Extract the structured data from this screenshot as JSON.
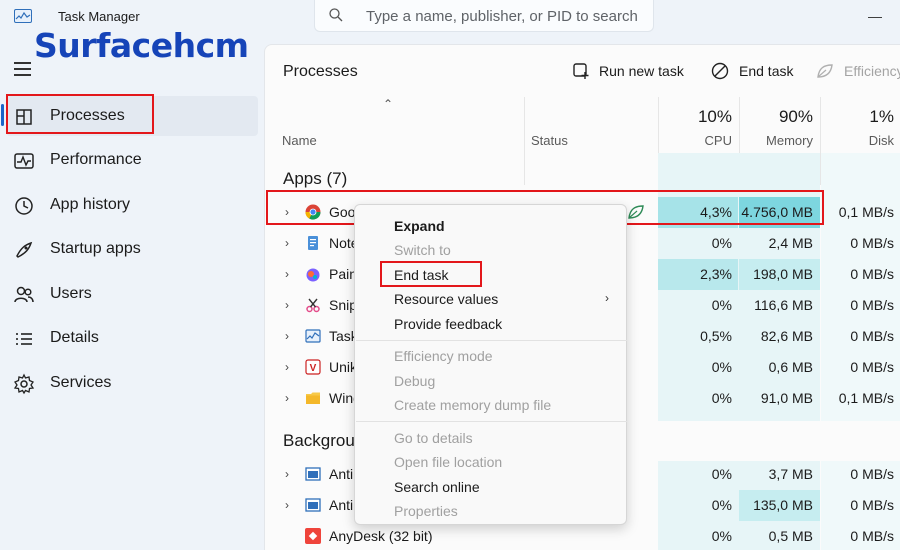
{
  "titlebar": {
    "app_title": "Task Manager",
    "search_placeholder": "Type a name, publisher, or PID to search",
    "minimize": "—",
    "maximize": "☐"
  },
  "watermark": "Surfacehcm",
  "sidebar": {
    "items": [
      {
        "label": "Processes",
        "icon": "processes-icon",
        "active": true
      },
      {
        "label": "Performance",
        "icon": "performance-icon"
      },
      {
        "label": "App history",
        "icon": "history-icon"
      },
      {
        "label": "Startup apps",
        "icon": "startup-icon"
      },
      {
        "label": "Users",
        "icon": "users-icon"
      },
      {
        "label": "Details",
        "icon": "details-icon"
      },
      {
        "label": "Services",
        "icon": "services-icon"
      }
    ]
  },
  "main": {
    "title": "Processes",
    "toolbar": {
      "run_new_task": "Run new task",
      "end_task": "End task",
      "efficiency": "Efficiency"
    },
    "columns": {
      "name": "Name",
      "status": "Status",
      "cpu_pct": "10%",
      "cpu": "CPU",
      "memory_pct": "90%",
      "memory": "Memory",
      "disk_pct": "1%",
      "disk": "Disk"
    },
    "groups": {
      "apps": "Apps (7)",
      "background": "Backgrou"
    },
    "rows": [
      {
        "name": "Goo",
        "icon": "chrome-icon",
        "cpu": "4,3%",
        "memory": "4.756,0 MB",
        "disk": "0,1 MB/s"
      },
      {
        "name": "Note",
        "icon": "notepad-icon",
        "cpu": "0%",
        "memory": "2,4 MB",
        "disk": "0 MB/s"
      },
      {
        "name": "Pain",
        "icon": "paint-icon",
        "cpu": "2,3%",
        "memory": "198,0 MB",
        "disk": "0 MB/s"
      },
      {
        "name": "Snip",
        "icon": "snip-icon",
        "cpu": "0%",
        "memory": "116,6 MB",
        "disk": "0 MB/s"
      },
      {
        "name": "Task",
        "icon": "taskmgr-icon",
        "cpu": "0,5%",
        "memory": "82,6 MB",
        "disk": "0 MB/s"
      },
      {
        "name": "Unik",
        "icon": "unikey-icon",
        "cpu": "0%",
        "memory": "0,6 MB",
        "disk": "0 MB/s"
      },
      {
        "name": "Wind",
        "icon": "folder-icon",
        "cpu": "0%",
        "memory": "91,0 MB",
        "disk": "0,1 MB/s"
      },
      {
        "name": "Anti",
        "icon": "app-icon",
        "cpu": "0%",
        "memory": "3,7 MB",
        "disk": "0 MB/s"
      },
      {
        "name": "Anti",
        "icon": "app-icon",
        "cpu": "0%",
        "memory": "135,0 MB",
        "disk": "0 MB/s"
      },
      {
        "name": "AnyDesk (32 bit)",
        "icon": "anydesk-icon",
        "cpu": "0%",
        "memory": "0,5 MB",
        "disk": "0 MB/s"
      }
    ]
  },
  "context_menu": {
    "expand": "Expand",
    "switch_to": "Switch to",
    "end_task": "End task",
    "resource_values": "Resource values",
    "provide_feedback": "Provide feedback",
    "efficiency_mode": "Efficiency mode",
    "debug": "Debug",
    "create_dump": "Create memory dump file",
    "go_to_details": "Go to details",
    "open_file_location": "Open file location",
    "search_online": "Search online",
    "properties": "Properties"
  },
  "colors": {
    "highlight_red": "#e3171b",
    "heat_light": "#d3f0f3",
    "heat_mid": "#a6e3e8",
    "accent": "#1b64c8"
  }
}
